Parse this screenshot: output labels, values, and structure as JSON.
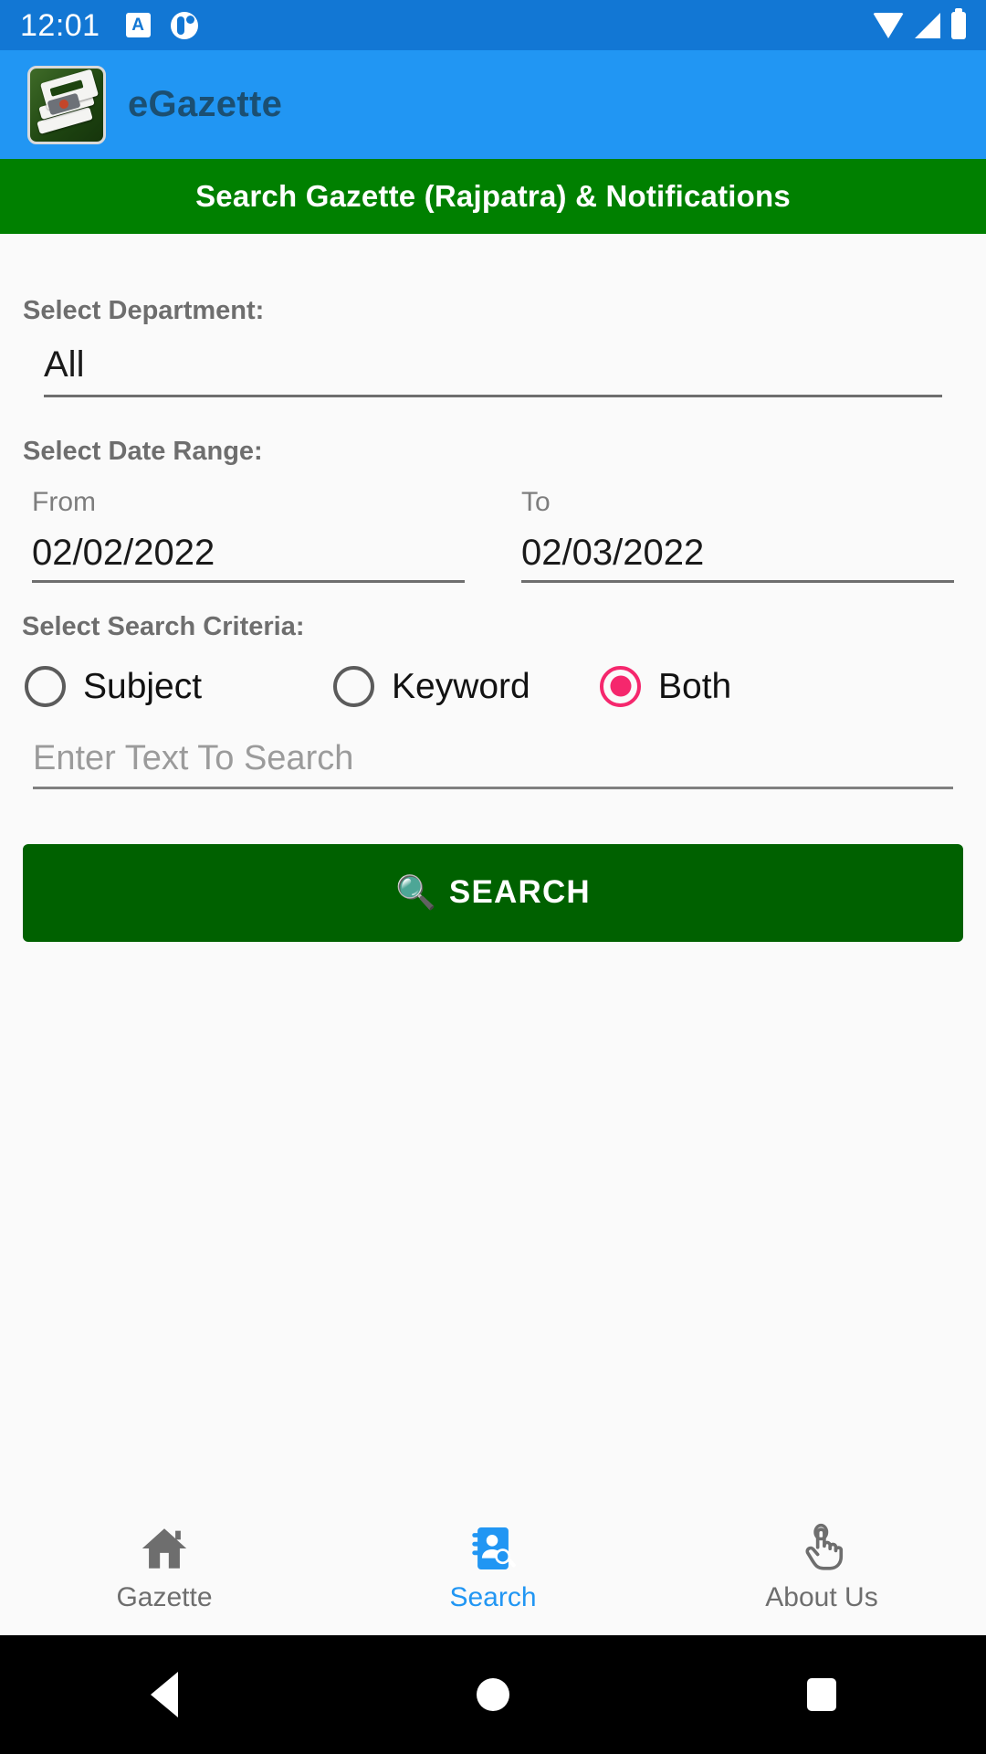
{
  "status_bar": {
    "time": "12:01",
    "icons": [
      "app-notification-icon",
      "media-notification-icon",
      "wifi-icon",
      "cellular-signal-icon",
      "battery-icon"
    ]
  },
  "app_bar": {
    "title": "eGazette",
    "logo": "egazette-books-logo"
  },
  "banner": {
    "title": "Search Gazette (Rajpatra) & Notifications"
  },
  "form": {
    "department_label": "Select Department:",
    "department_value": "All",
    "date_range_label": "Select Date Range:",
    "from_caption": "From",
    "from_value": "02/02/2022",
    "to_caption": "To",
    "to_value": "02/03/2022",
    "criteria_label": "Select Search Criteria:",
    "criteria_options": [
      {
        "label": "Subject",
        "selected": false
      },
      {
        "label": "Keyword",
        "selected": false
      },
      {
        "label": "Both",
        "selected": true
      }
    ],
    "search_placeholder": "Enter Text To Search",
    "search_value": "",
    "search_button_label": "SEARCH",
    "search_button_icon": "🔍"
  },
  "bottom_nav": {
    "items": [
      {
        "label": "Gazette",
        "icon": "home-icon",
        "active": false
      },
      {
        "label": "Search",
        "icon": "contact-search-icon",
        "active": true
      },
      {
        "label": "About Us",
        "icon": "pointing-hand-icon",
        "active": false
      }
    ]
  },
  "android_nav": {
    "back": "back-button",
    "home": "home-button",
    "recents": "recents-button"
  },
  "colors": {
    "status_bar": "#1277d4",
    "app_bar": "#2196f3",
    "banner_green": "#008000",
    "button_green": "#006100",
    "accent_pink": "#f5276d",
    "active_blue": "#2196f3"
  }
}
